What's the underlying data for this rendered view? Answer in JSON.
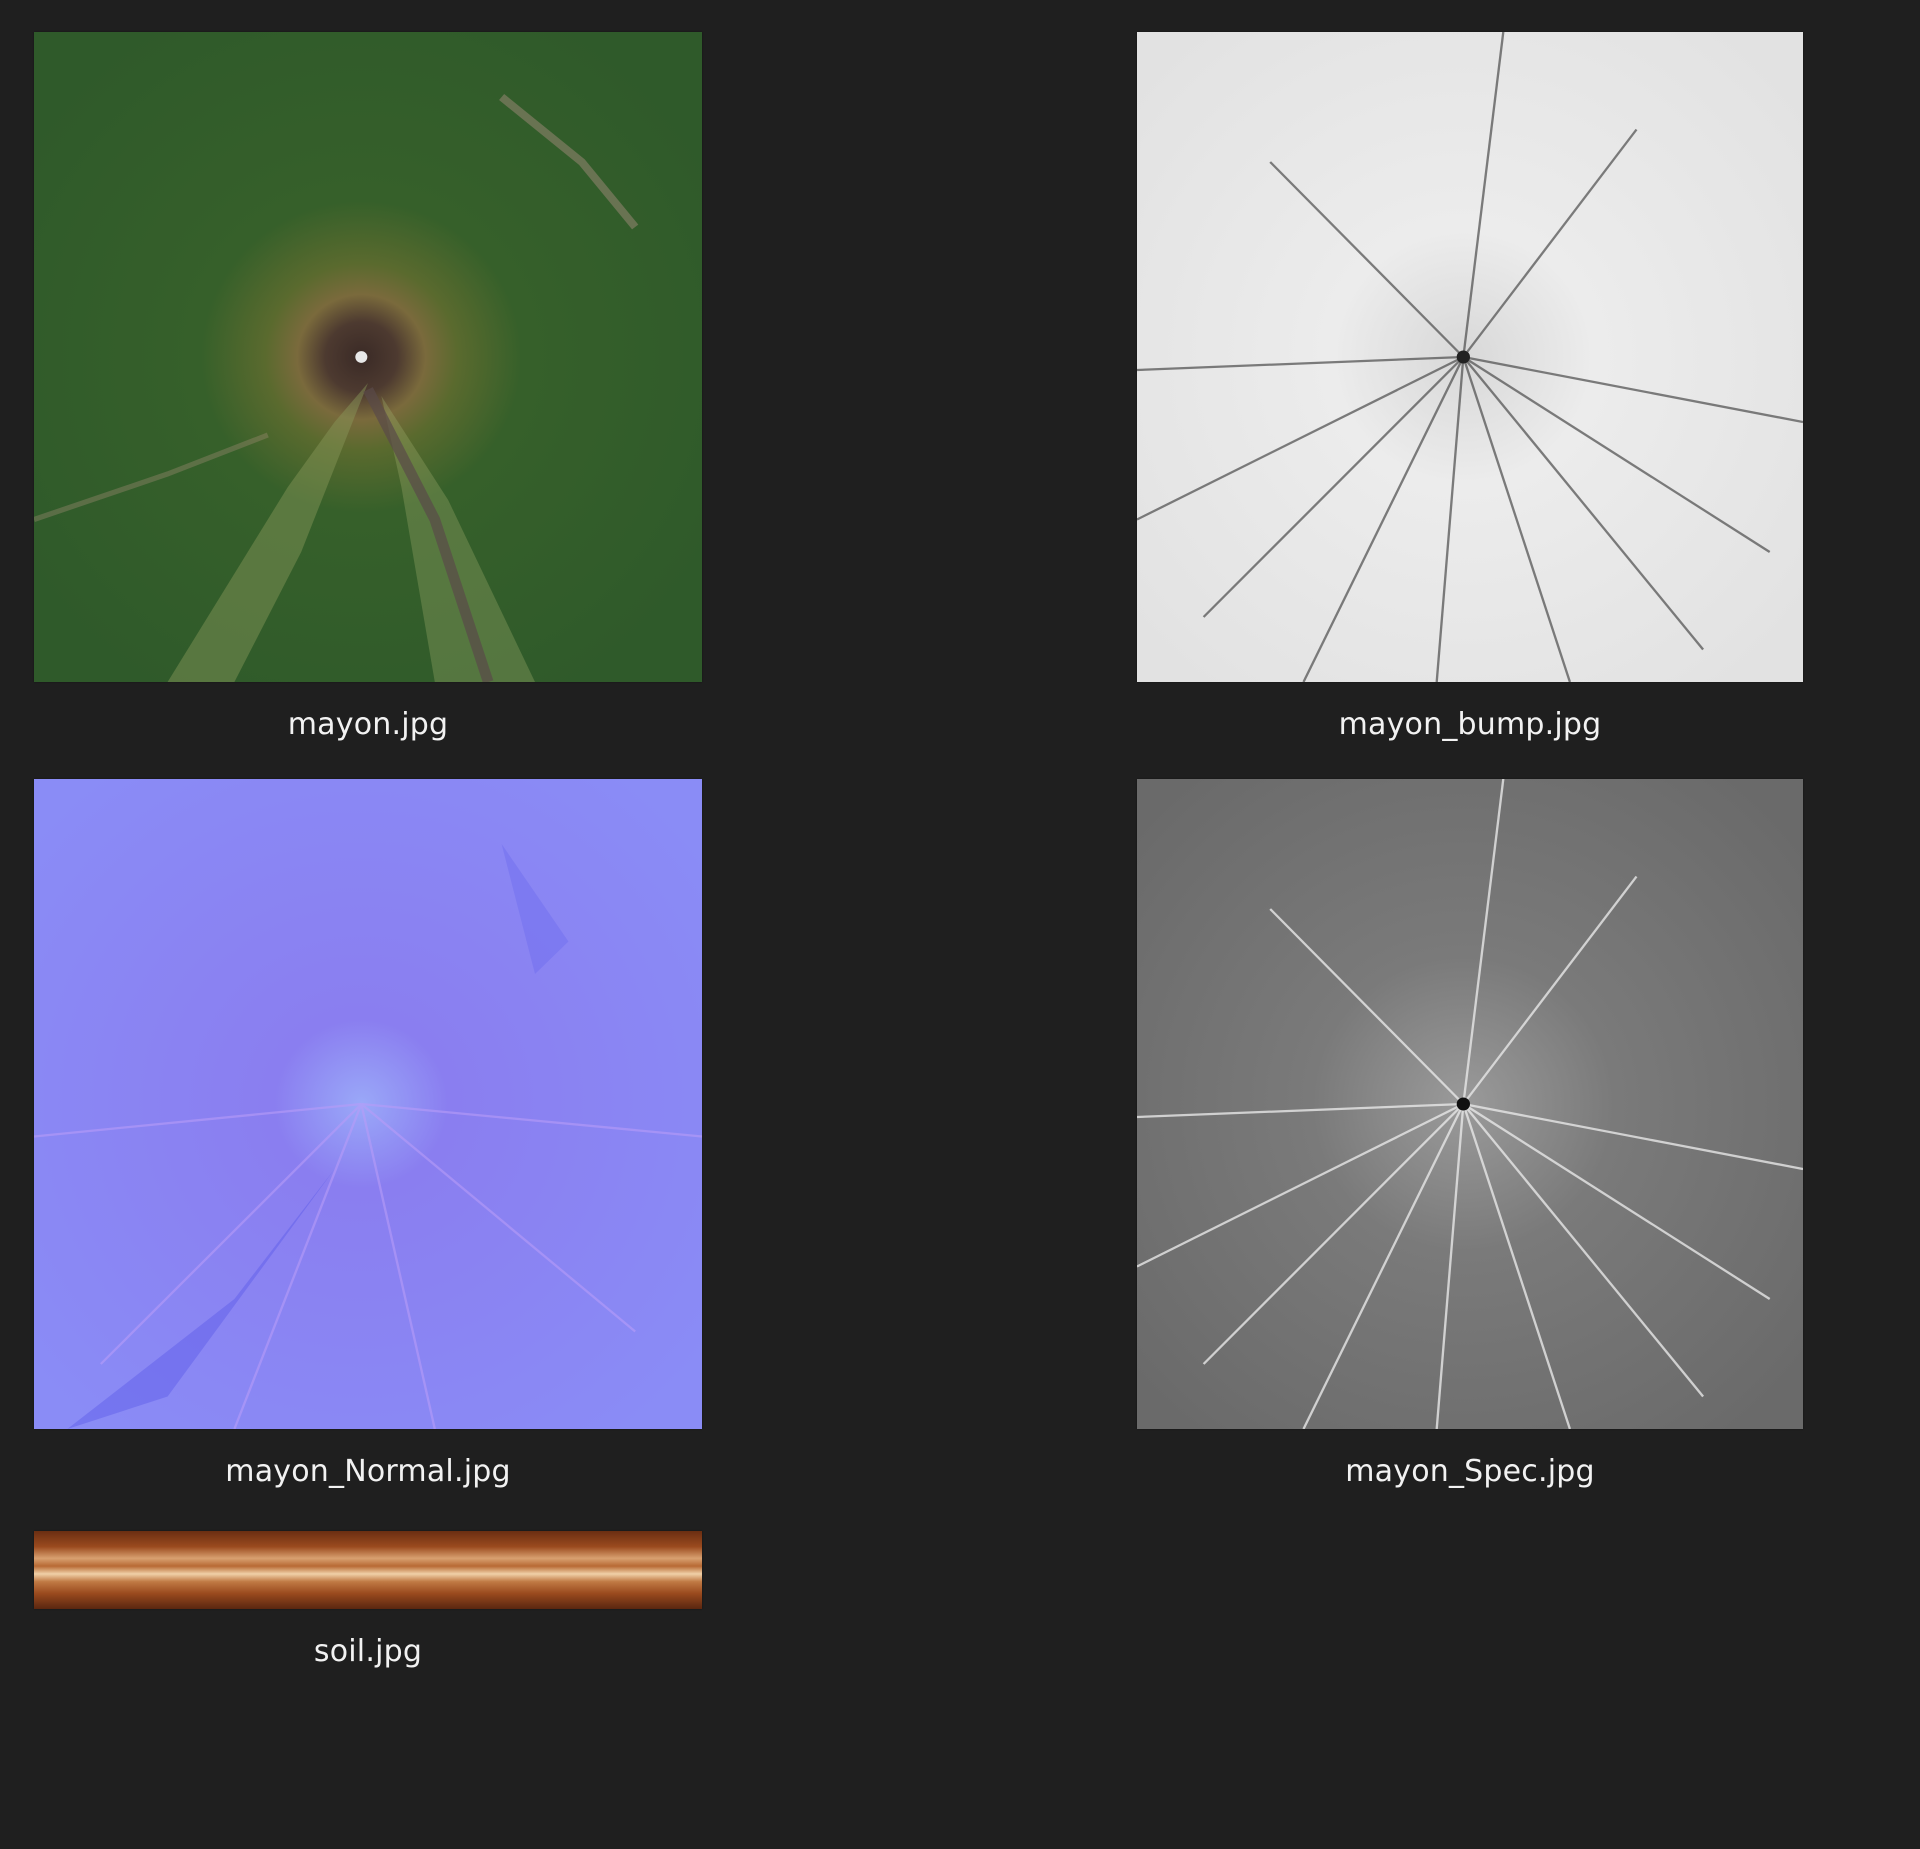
{
  "files": {
    "mayon": {
      "name": "mayon.jpg",
      "thumbnail": "satellite-volcano-texture"
    },
    "mayon_bump": {
      "name": "mayon_bump.jpg",
      "thumbnail": "grayscale-bump-map"
    },
    "mayon_normal": {
      "name": "mayon_Normal.jpg",
      "thumbnail": "purple-normal-map"
    },
    "mayon_spec": {
      "name": "mayon_Spec.jpg",
      "thumbnail": "gray-specular-map"
    },
    "soil": {
      "name": "soil.jpg",
      "thumbnail": "soil-strata-texture"
    }
  },
  "colors": {
    "background": "#1f1f1f",
    "label": "#f2f2f2"
  }
}
